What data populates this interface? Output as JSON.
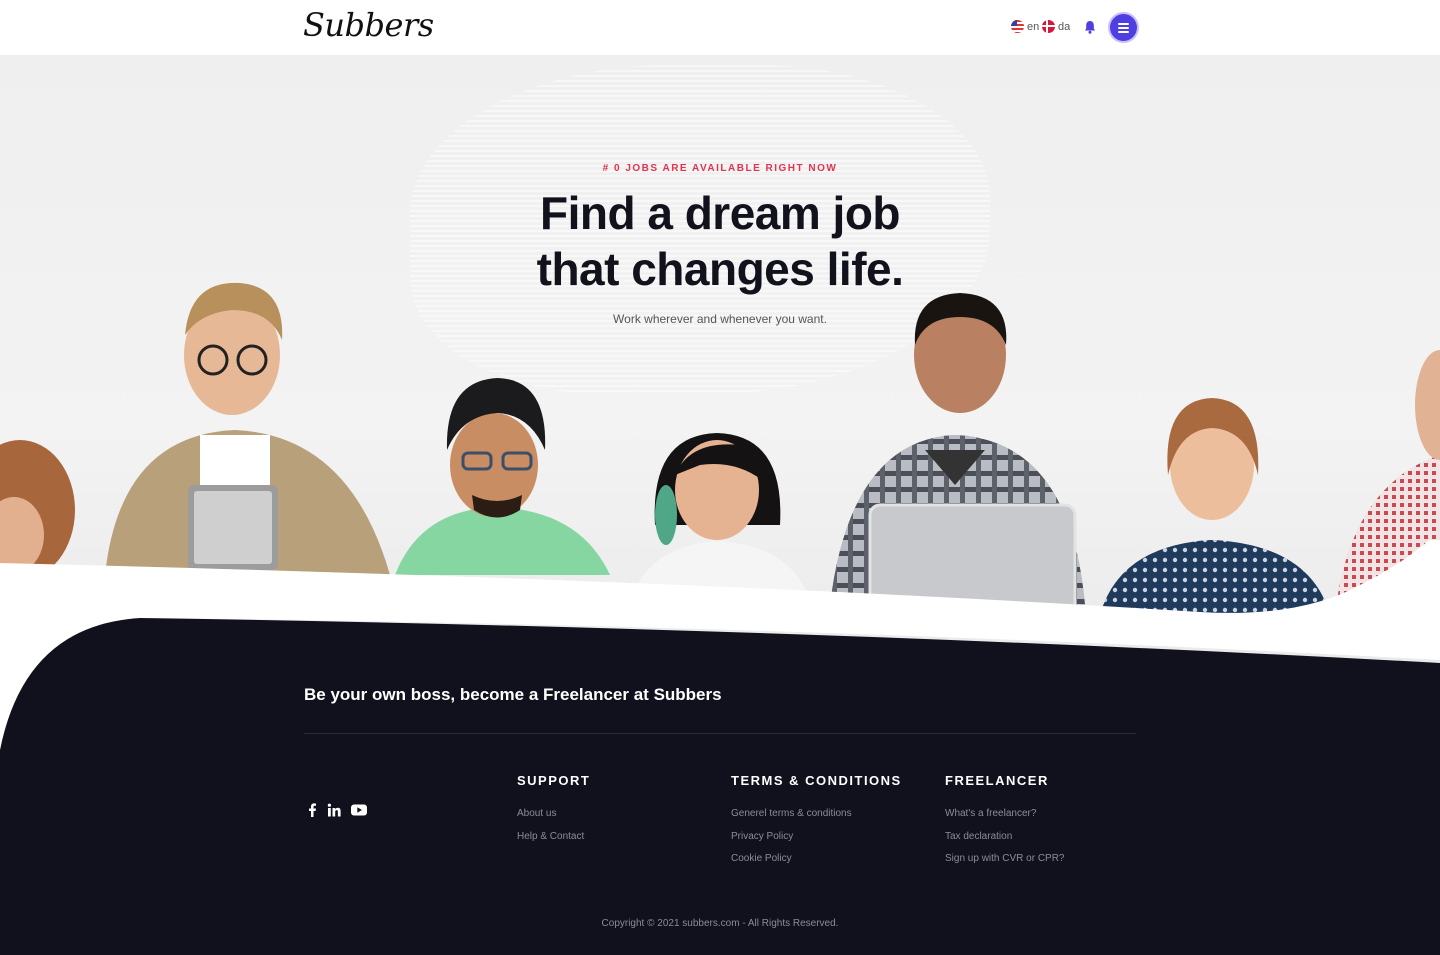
{
  "header": {
    "logo": "Subbers",
    "languages": [
      {
        "code": "en",
        "label": "en"
      },
      {
        "code": "da",
        "label": "da"
      }
    ]
  },
  "hero": {
    "eyebrow": "# 0 JOBS ARE AVAILABLE RIGHT NOW",
    "headline_line1": "Find a dream job",
    "headline_line2": "that changes life.",
    "subline": "Work wherever and whenever you want."
  },
  "footer": {
    "tagline": "Be your own boss, become a Freelancer at Subbers",
    "socials": [
      "facebook-icon",
      "linkedin-icon",
      "youtube-icon"
    ],
    "columns": [
      {
        "title": "SUPPORT",
        "links": [
          "About us",
          "Help & Contact"
        ]
      },
      {
        "title": "TERMS & CONDITIONS",
        "links": [
          "Generel terms & conditions",
          "Privacy Policy",
          "Cookie Policy"
        ]
      },
      {
        "title": "FREELANCER",
        "links": [
          "What's a freelancer?",
          "Tax declaration",
          "Sign up with CVR or CPR?"
        ]
      }
    ],
    "copyright": "Copyright © 2021 subbers.com - All Rights Reserved."
  },
  "colors": {
    "accent": "#4f3fe0",
    "eyebrow": "#e0344f",
    "footer_bg": "#10111c",
    "headline": "#11121c"
  }
}
